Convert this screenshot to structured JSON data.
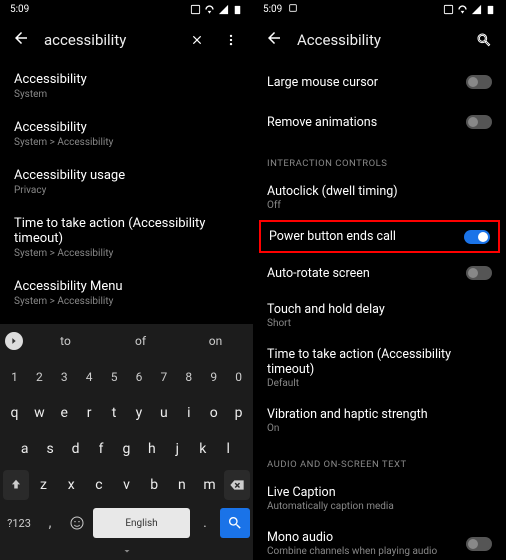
{
  "left": {
    "time": "5:09",
    "search_query": "accessibility",
    "results": [
      {
        "title": "Accessibility",
        "sub": "System"
      },
      {
        "title": "Accessibility",
        "sub": "System > Accessibility"
      },
      {
        "title": "Accessibility usage",
        "sub": "Privacy"
      },
      {
        "title": "Time to take action (Accessibility timeout)",
        "sub": "System > Accessibility"
      },
      {
        "title": "Accessibility Menu",
        "sub": "System > Accessibility"
      }
    ],
    "suggestions": [
      "to",
      "of",
      "on"
    ],
    "keyboard": {
      "nums": [
        "1",
        "2",
        "3",
        "4",
        "5",
        "6",
        "7",
        "8",
        "9",
        "0"
      ],
      "row_q": [
        "q",
        "w",
        "e",
        "r",
        "t",
        "y",
        "u",
        "i",
        "o",
        "p"
      ],
      "row_a": [
        "a",
        "s",
        "d",
        "f",
        "g",
        "h",
        "j",
        "k",
        "l"
      ],
      "row_z": [
        "z",
        "x",
        "c",
        "v",
        "b",
        "n",
        "m"
      ],
      "sym_key": "?123",
      "comma": ",",
      "space_label": "English",
      "dot": "."
    }
  },
  "right": {
    "time": "5:09",
    "title": "Accessibility",
    "items_top": [
      {
        "title": "Large mouse cursor",
        "toggle": false
      },
      {
        "title": "Remove animations",
        "toggle": false
      }
    ],
    "section1": "INTERACTION CONTROLS",
    "items_interaction": [
      {
        "title": "Autoclick (dwell timing)",
        "sub": "Off"
      },
      {
        "title": "Power button ends call",
        "toggle": true,
        "highlight": true
      },
      {
        "title": "Auto-rotate screen",
        "toggle": false
      },
      {
        "title": "Touch and hold delay",
        "sub": "Short"
      },
      {
        "title": "Time to take action (Accessibility timeout)",
        "sub": "Default"
      },
      {
        "title": "Vibration and haptic strength",
        "sub": "On"
      }
    ],
    "section2": "AUDIO AND ON-SCREEN TEXT",
    "items_audio": [
      {
        "title": "Live Caption",
        "sub": "Automatically caption media"
      },
      {
        "title": "Mono audio",
        "sub": "Combine channels when playing audio",
        "toggle": false
      }
    ]
  }
}
